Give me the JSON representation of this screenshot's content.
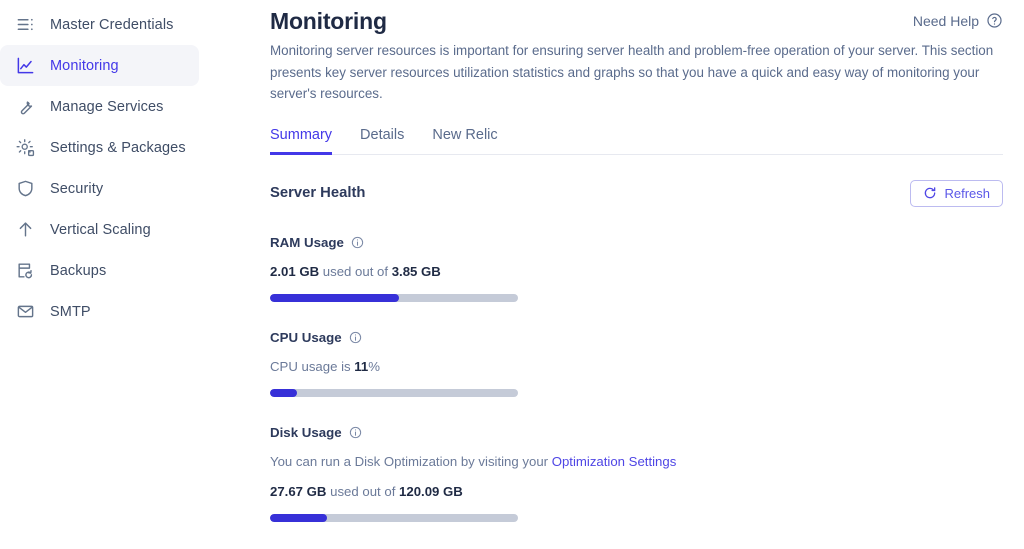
{
  "sidebar": {
    "items": [
      {
        "label": "Master Credentials",
        "icon": "list-menu-icon",
        "active": false
      },
      {
        "label": "Monitoring",
        "icon": "chart-line-icon",
        "active": true
      },
      {
        "label": "Manage Services",
        "icon": "wrench-icon",
        "active": false
      },
      {
        "label": "Settings & Packages",
        "icon": "gear-icon",
        "active": false
      },
      {
        "label": "Security",
        "icon": "shield-icon",
        "active": false
      },
      {
        "label": "Vertical Scaling",
        "icon": "arrow-up-icon",
        "active": false
      },
      {
        "label": "Backups",
        "icon": "backup-restore-icon",
        "active": false
      },
      {
        "label": "SMTP",
        "icon": "envelope-icon",
        "active": false
      }
    ]
  },
  "header": {
    "title": "Monitoring",
    "need_help_label": "Need Help",
    "help_icon": "question-circle-icon",
    "description": "Monitoring server resources is important for ensuring server health and problem-free operation of your server. This section presents key server resources utilization statistics and graphs so that you have a quick and easy way of monitoring your server's resources."
  },
  "tabs": [
    {
      "label": "Summary",
      "active": true
    },
    {
      "label": "Details",
      "active": false
    },
    {
      "label": "New Relic",
      "active": false
    }
  ],
  "server_health": {
    "title": "Server Health",
    "refresh_label": "Refresh",
    "refresh_icon": "refresh-icon"
  },
  "metrics": {
    "ram": {
      "name": "RAM Usage",
      "info_icon": "info-circle-icon",
      "used_value": "2.01 GB",
      "middle_text": " used out of ",
      "total_value": "3.85 GB",
      "percent": 52
    },
    "cpu": {
      "name": "CPU Usage",
      "info_icon": "info-circle-icon",
      "prefix_text": "CPU usage is ",
      "value": "11",
      "suffix_text": "%",
      "percent": 11
    },
    "disk": {
      "name": "Disk Usage",
      "info_icon": "info-circle-icon",
      "note_prefix": "You can run a Disk Optimization by visiting your ",
      "note_link": "Optimization Settings",
      "used_value": "27.67 GB",
      "middle_text": " used out of ",
      "total_value": "120.09 GB",
      "percent": 23
    }
  },
  "colors": {
    "accent": "#4338e8",
    "bar_fill": "#3730d8",
    "bar_track": "#c5cbd8",
    "heading": "#1f2a44",
    "body_text": "#5a6b8c"
  }
}
